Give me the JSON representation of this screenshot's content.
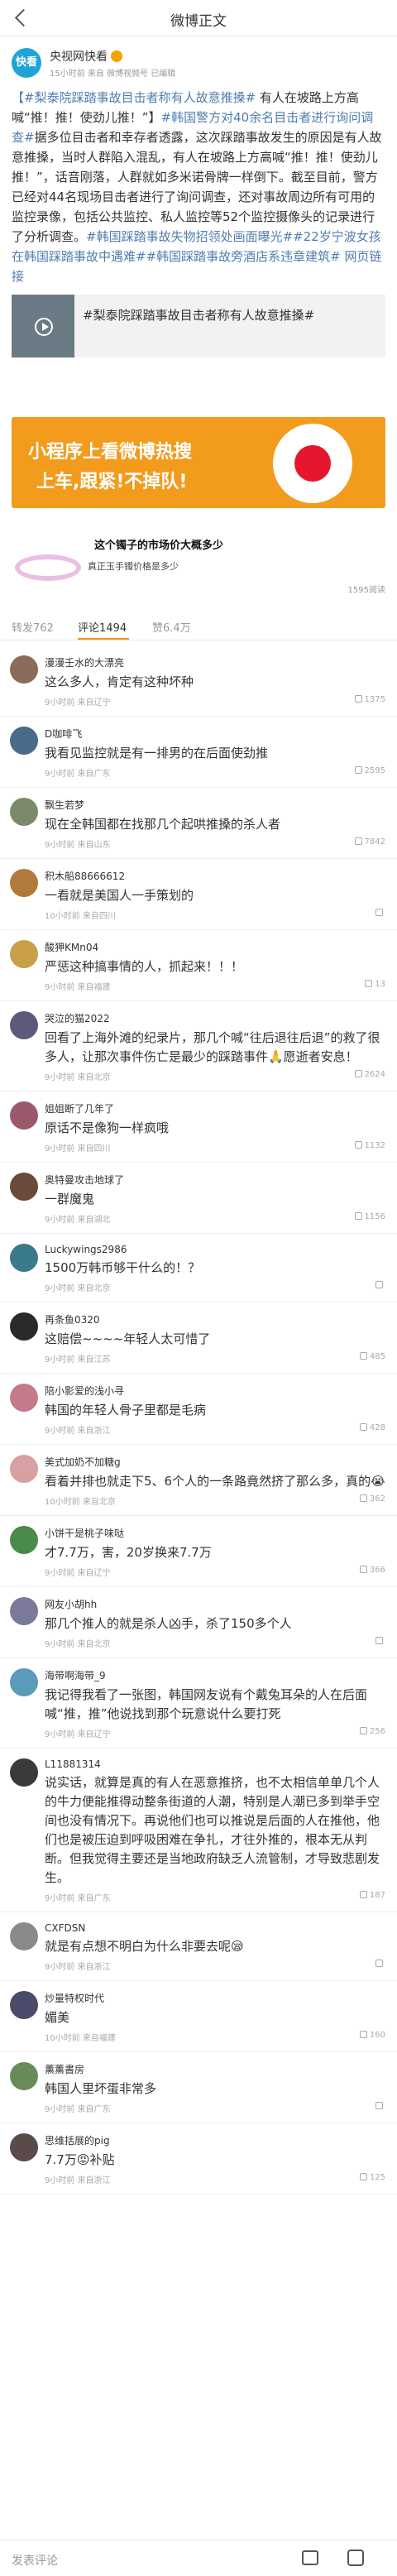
{
  "topbar": {
    "title": "微博正文"
  },
  "post": {
    "avatar_text": "快看",
    "user": "央视网快看",
    "meta": "15小时前 来自 微博视频号 已编辑",
    "text_parts": [
      {
        "t": "【#梨泰院踩踏事故目击者称有人故意推搡#",
        "blue": true
      },
      {
        "t": " 有人在坡路上方高喊“推！推！使劲儿推！”】",
        "blue": false
      },
      {
        "t": "#韩国警方对40余名目击者进行询问调查#",
        "blue": true
      },
      {
        "t": "据多位目击者和幸存者透露，这次踩踏事故发生的原因是有人故意推搡，当时人群陷入混乱，有人在坡路上方高喊“推！推！使劲儿推！”，话音刚落，人群就如多米诺骨牌一样倒下。截至目前，警方已经对44名现场目击者进行了询问调查，还对事故周边所有可用的监控录像，包括公共监控、私人监控等52个监控摄像头的记录进行了分析调查。",
        "blue": false
      },
      {
        "t": "#韩国踩踏事故失物招领处画面曝光##22岁宁波女孩在韩国踩踏事故中遇难##韩国踩踏事故旁酒店系违章建筑#",
        "blue": true
      },
      {
        "t": " 网页链接",
        "blue": true
      }
    ],
    "video_title": "#梨泰院踩踏事故目击者称有人故意推搡#"
  },
  "banner": {
    "line1": "小程序上看微博热搜",
    "line2": "上车,跟紧!不掉队!"
  },
  "ad": {
    "title": "这个镯子的市场价大概多少",
    "sub": "真正玉手镯价格是多少",
    "count": "1595阅读"
  },
  "tabs": {
    "repost": "转发762",
    "comments": "评论1494",
    "likes": "赞6.4万"
  },
  "comments": [
    {
      "name": "漫漫壬水的大漂亮",
      "text": "这么多人，肯定有这种坏种",
      "meta": "9小时前 来自辽宁",
      "likes": "1375",
      "color": "#8a6b5c"
    },
    {
      "name": "D咖啡飞",
      "text": "我看见监控就是有一排男的在后面使劲推",
      "meta": "9小时前 来自广东",
      "likes": "2595",
      "color": "#4a6a8a"
    },
    {
      "name": "飘生若梦",
      "text": "现在全韩国都在找那几个起哄推搡的杀人者",
      "meta": "9小时前 来自山东",
      "likes": "7842",
      "color": "#7a8a6a"
    },
    {
      "name": "积木船88666612",
      "text": "一看就是美国人一手策划的",
      "meta": "10小时前 来自四川",
      "likes": "",
      "color": "#b07a3a"
    },
    {
      "name": "酸狎KMn04",
      "text": "严惩这种搞事情的人，抓起来！！！",
      "meta": "9小时前 来自福建",
      "likes": "13",
      "color": "#c9a04a"
    },
    {
      "name": "哭泣的猫2022",
      "text": "回看了上海外滩的纪录片，那几个喊“往后退往后退”的救了很多人，让那次事件伤亡是最少的踩踏事件🙏愿逝者安息！",
      "meta": "9小时前 来自北京",
      "likes": "2624",
      "color": "#5a5a7a"
    },
    {
      "name": "姐姐断了几年了",
      "text": "原话不是像狗一样疯哦",
      "meta": "9小时前 来自四川",
      "likes": "1132",
      "color": "#9a5a6a"
    },
    {
      "name": "奥特曼攻击地球了",
      "text": "一群魔鬼",
      "meta": "9小时前 来自湖北",
      "likes": "1156",
      "color": "#6a4a3a"
    },
    {
      "name": "Luckywings2986",
      "text": "1500万韩币够干什么的！？",
      "meta": "9小时前 来自北京",
      "likes": "",
      "color": "#3a7a8a"
    },
    {
      "name": "再条鱼0320",
      "text": "这赔偿~~~~年轻人太可惜了",
      "meta": "9小时前 来自江苏",
      "likes": "485",
      "color": "#2a2a2a"
    },
    {
      "name": "陪小影爱的浅小寻",
      "text": "韩国的年轻人骨子里都是毛病",
      "meta": "9小时前 来自浙江",
      "likes": "428",
      "color": "#c47a8a"
    },
    {
      "name": "美式加奶不加糖g",
      "text": "看着并排也就走下5、6个人的一条路竟然挤了那么多，真的😭",
      "meta": "10小时前 来自北京",
      "likes": "362",
      "color": "#d8a0a0"
    },
    {
      "name": "小饼干是桃子味哒",
      "text": "才7.7万，害，20岁换来7.7万",
      "meta": "9小时前 来自辽宁",
      "likes": "366",
      "color": "#4a8a4a"
    },
    {
      "name": "网友小胡hh",
      "text": "那几个推人的就是杀人凶手，杀了150多个人",
      "meta": "9小时前 来自北京",
      "likes": "",
      "color": "#7a7a9a"
    },
    {
      "name": "海带啊海带_9",
      "text": "我记得我看了一张图，韩国网友说有个戴兔耳朵的人在后面喊“推，推”他说找到那个玩意说什么要打死",
      "meta": "9小时前 来自辽宁",
      "likes": "256",
      "color": "#5a9aba"
    },
    {
      "name": "L11881314",
      "text": "说实话，就算是真的有人在恶意推挤，也不太相信单单几个人的牛力便能推得动整条街道的人潮，特别是人潮已多到举手空间也没有情况下。再说他们也可以推说是后面的人在推他，他们也是被压迫到呼吸困难在争扎，才往外推的，根本无从判断。但我觉得主要还是当地政府缺乏人流管制，才导致悲剧发生。",
      "meta": "9小时前 来自广东",
      "likes": "187",
      "color": "#3a3a3a"
    },
    {
      "name": "CXFDSN",
      "text": "就是有点想不明白为什么非要去呢😪",
      "meta": "9小时前 来自浙江",
      "likes": "",
      "color": "#8a8a8a"
    },
    {
      "name": "炒量特权时代",
      "text": "媚美",
      "meta": "10小时前 来自福建",
      "likes": "160",
      "color": "#4a4a6a"
    },
    {
      "name": "薰薰書房",
      "text": "韩国人里坏蛋非常多",
      "meta": "9小时前 来自广东",
      "likes": "",
      "color": "#6a8a5a"
    },
    {
      "name": "思维括展的pig",
      "text": "7.7万😡补贴",
      "meta": "9小时前 来自浙江",
      "likes": "125",
      "color": "#5a4a4a"
    }
  ],
  "bottombar": {
    "input": "发表评论"
  }
}
